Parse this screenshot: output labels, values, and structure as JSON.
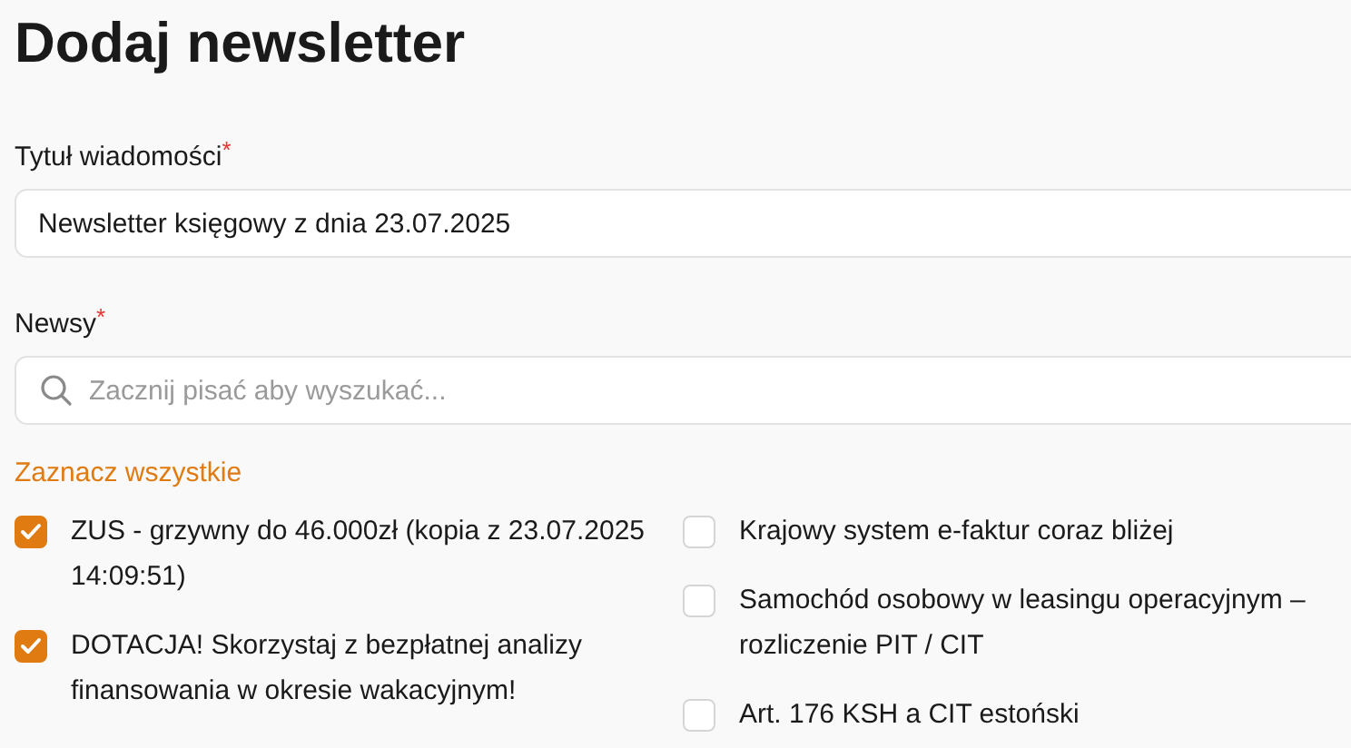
{
  "heading": "Dodaj newsletter",
  "title_field": {
    "label": "Tytuł wiadomości",
    "required": true,
    "required_mark": "*",
    "value": "Newsletter księgowy z dnia 23.07.2025"
  },
  "news_field": {
    "label": "Newsy",
    "required": true,
    "required_mark": "*",
    "placeholder": "Zacznij pisać aby wyszukać..."
  },
  "select_all": "Zaznacz wszystkie",
  "news_columns": [
    [
      {
        "label": "ZUS - grzywny do 46.000zł (kopia z 23.07.2025 14:09:51)",
        "checked": true
      },
      {
        "label": "DOTACJA! Skorzystaj z bezpłatnej analizy finansowania w okresie wakacyjnym!",
        "checked": true
      }
    ],
    [
      {
        "label": "Krajowy system e-faktur coraz bliżej",
        "checked": false
      },
      {
        "label": "Samochód osobowy w leasingu operacyjnym – rozliczenie PIT / CIT",
        "checked": false
      },
      {
        "label": "Art. 176 KSH a CIT estoński",
        "checked": false
      }
    ]
  ]
}
